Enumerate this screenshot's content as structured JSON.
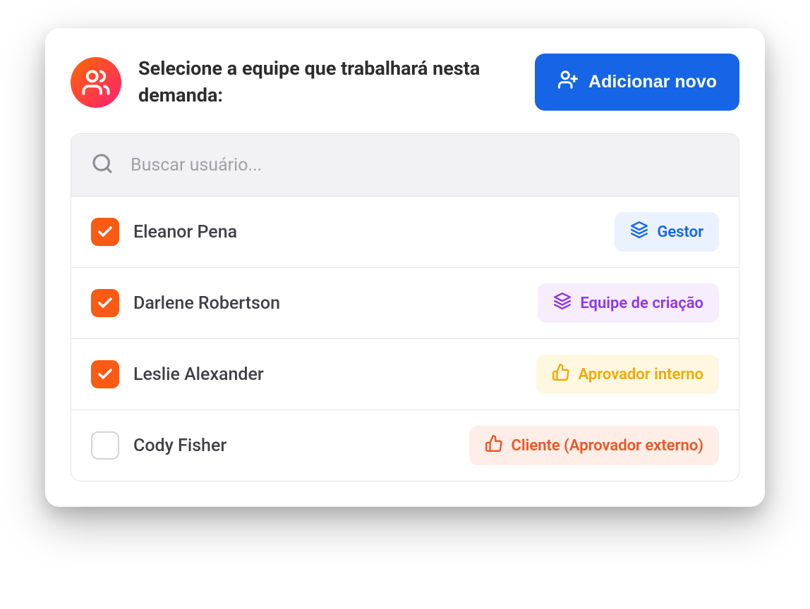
{
  "header": {
    "title": "Selecione a equipe que trabalhará nesta demanda:",
    "add_button_label": "Adicionar novo"
  },
  "search": {
    "placeholder": "Buscar usuário..."
  },
  "users": [
    {
      "name": "Eleanor Pena",
      "checked": true,
      "role_label": "Gestor",
      "role_type": "gestor",
      "role_icon": "layers"
    },
    {
      "name": "Darlene Robertson",
      "checked": true,
      "role_label": "Equipe de criação",
      "role_type": "equipe",
      "role_icon": "layers"
    },
    {
      "name": "Leslie Alexander",
      "checked": true,
      "role_label": "Aprovador interno",
      "role_type": "aprovador-interno",
      "role_icon": "thumbs-up"
    },
    {
      "name": "Cody Fisher",
      "checked": false,
      "role_label": "Cliente (Aprovador externo)",
      "role_type": "aprovador-externo",
      "role_icon": "thumbs-up"
    }
  ]
}
